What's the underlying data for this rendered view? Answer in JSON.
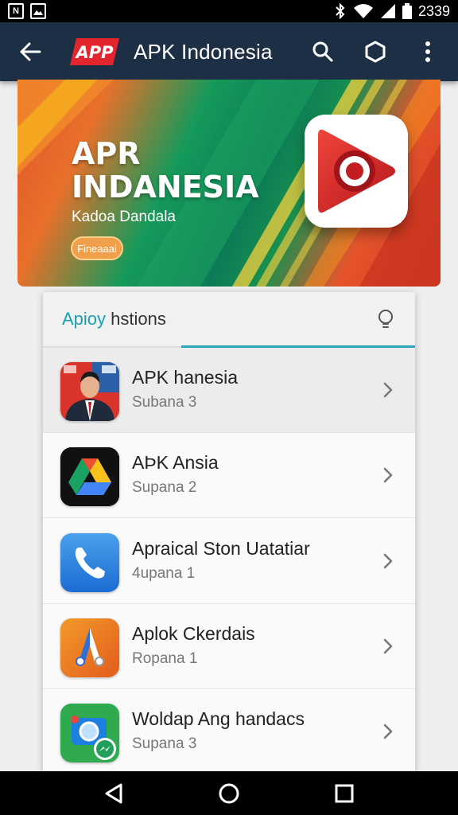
{
  "status_bar": {
    "time": "2339",
    "left_icons": [
      "n-notification-icon",
      "image-notification-icon"
    ],
    "right_icons": [
      "bluetooth-icon",
      "wifi-icon",
      "signal-icon",
      "battery-icon"
    ]
  },
  "app_bar": {
    "logo_text": "APP",
    "title": "APK Indonesia",
    "actions": [
      "search-icon",
      "hexagon-icon",
      "more-vert-icon"
    ]
  },
  "banner": {
    "title_line1": "APR",
    "title_line2": "INDANESIA",
    "subtitle": "Kadoa Dandala",
    "button_label": "Fineaaai"
  },
  "card": {
    "header_accent": "Apioy",
    "header_rest": " hstions",
    "items": [
      {
        "title": "APK hanesia",
        "subtitle": "Subana 3",
        "icon": "person-photo-icon"
      },
      {
        "title": "AÞK Ansia",
        "subtitle": "Supana 2",
        "icon": "drive-icon"
      },
      {
        "title": "Apraical Ston Uatatiar",
        "subtitle": "4upana 1",
        "icon": "phone-icon"
      },
      {
        "title": "Aplok Ckerdais",
        "subtitle": "Ropana 1",
        "icon": "a-letter-icon"
      },
      {
        "title": "Woldap Ang handacs",
        "subtitle": "Supana 3",
        "icon": "camera-messenger-icon"
      }
    ]
  },
  "colors": {
    "app_bar": "#1d2f45",
    "accent": "#2aa6b8",
    "logo_red": "#e3262d"
  }
}
